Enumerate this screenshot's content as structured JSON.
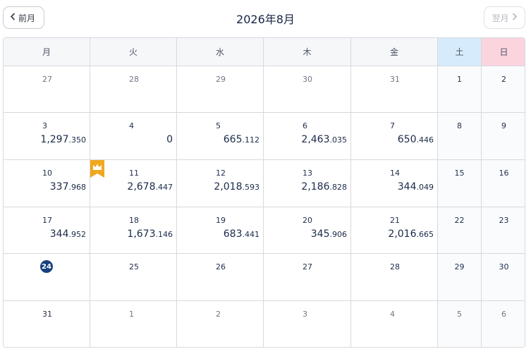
{
  "header": {
    "prev_label": "前月",
    "next_label": "翌月",
    "title": "2026年8月"
  },
  "weekdays": [
    "月",
    "火",
    "水",
    "木",
    "金",
    "土",
    "日"
  ],
  "weeks": [
    [
      {
        "day": "27",
        "other": true
      },
      {
        "day": "28",
        "other": true
      },
      {
        "day": "29",
        "other": true
      },
      {
        "day": "30",
        "other": true
      },
      {
        "day": "31",
        "other": true
      },
      {
        "day": "1"
      },
      {
        "day": "2"
      }
    ],
    [
      {
        "day": "3",
        "int": "1,297",
        "dec": ".350"
      },
      {
        "day": "4",
        "int": "0",
        "dec": ""
      },
      {
        "day": "5",
        "int": "665",
        "dec": ".112"
      },
      {
        "day": "6",
        "int": "2,463",
        "dec": ".035"
      },
      {
        "day": "7",
        "int": "650",
        "dec": ".446"
      },
      {
        "day": "8"
      },
      {
        "day": "9"
      }
    ],
    [
      {
        "day": "10",
        "int": "337",
        "dec": ".968"
      },
      {
        "day": "11",
        "int": "2,678",
        "dec": ".447",
        "badge": "crown-icon"
      },
      {
        "day": "12",
        "int": "2,018",
        "dec": ".593"
      },
      {
        "day": "13",
        "int": "2,186",
        "dec": ".828"
      },
      {
        "day": "14",
        "int": "344",
        "dec": ".049"
      },
      {
        "day": "15"
      },
      {
        "day": "16"
      }
    ],
    [
      {
        "day": "17",
        "int": "344",
        "dec": ".952"
      },
      {
        "day": "18",
        "int": "1,673",
        "dec": ".146"
      },
      {
        "day": "19",
        "int": "683",
        "dec": ".441"
      },
      {
        "day": "20",
        "int": "345",
        "dec": ".906"
      },
      {
        "day": "21",
        "int": "2,016",
        "dec": ".665"
      },
      {
        "day": "22"
      },
      {
        "day": "23"
      }
    ],
    [
      {
        "day": "24",
        "today": true
      },
      {
        "day": "25"
      },
      {
        "day": "26"
      },
      {
        "day": "27"
      },
      {
        "day": "28"
      },
      {
        "day": "29"
      },
      {
        "day": "30"
      }
    ],
    [
      {
        "day": "31"
      },
      {
        "day": "1",
        "other": true
      },
      {
        "day": "2",
        "other": true
      },
      {
        "day": "3",
        "other": true
      },
      {
        "day": "4",
        "other": true
      },
      {
        "day": "5",
        "other": true
      },
      {
        "day": "6",
        "other": true
      }
    ]
  ],
  "colors": {
    "saturday_header": "#d6ebfb",
    "sunday_header": "#fbd4de",
    "today_circle": "#17427e",
    "badge": "#f0a81e"
  }
}
